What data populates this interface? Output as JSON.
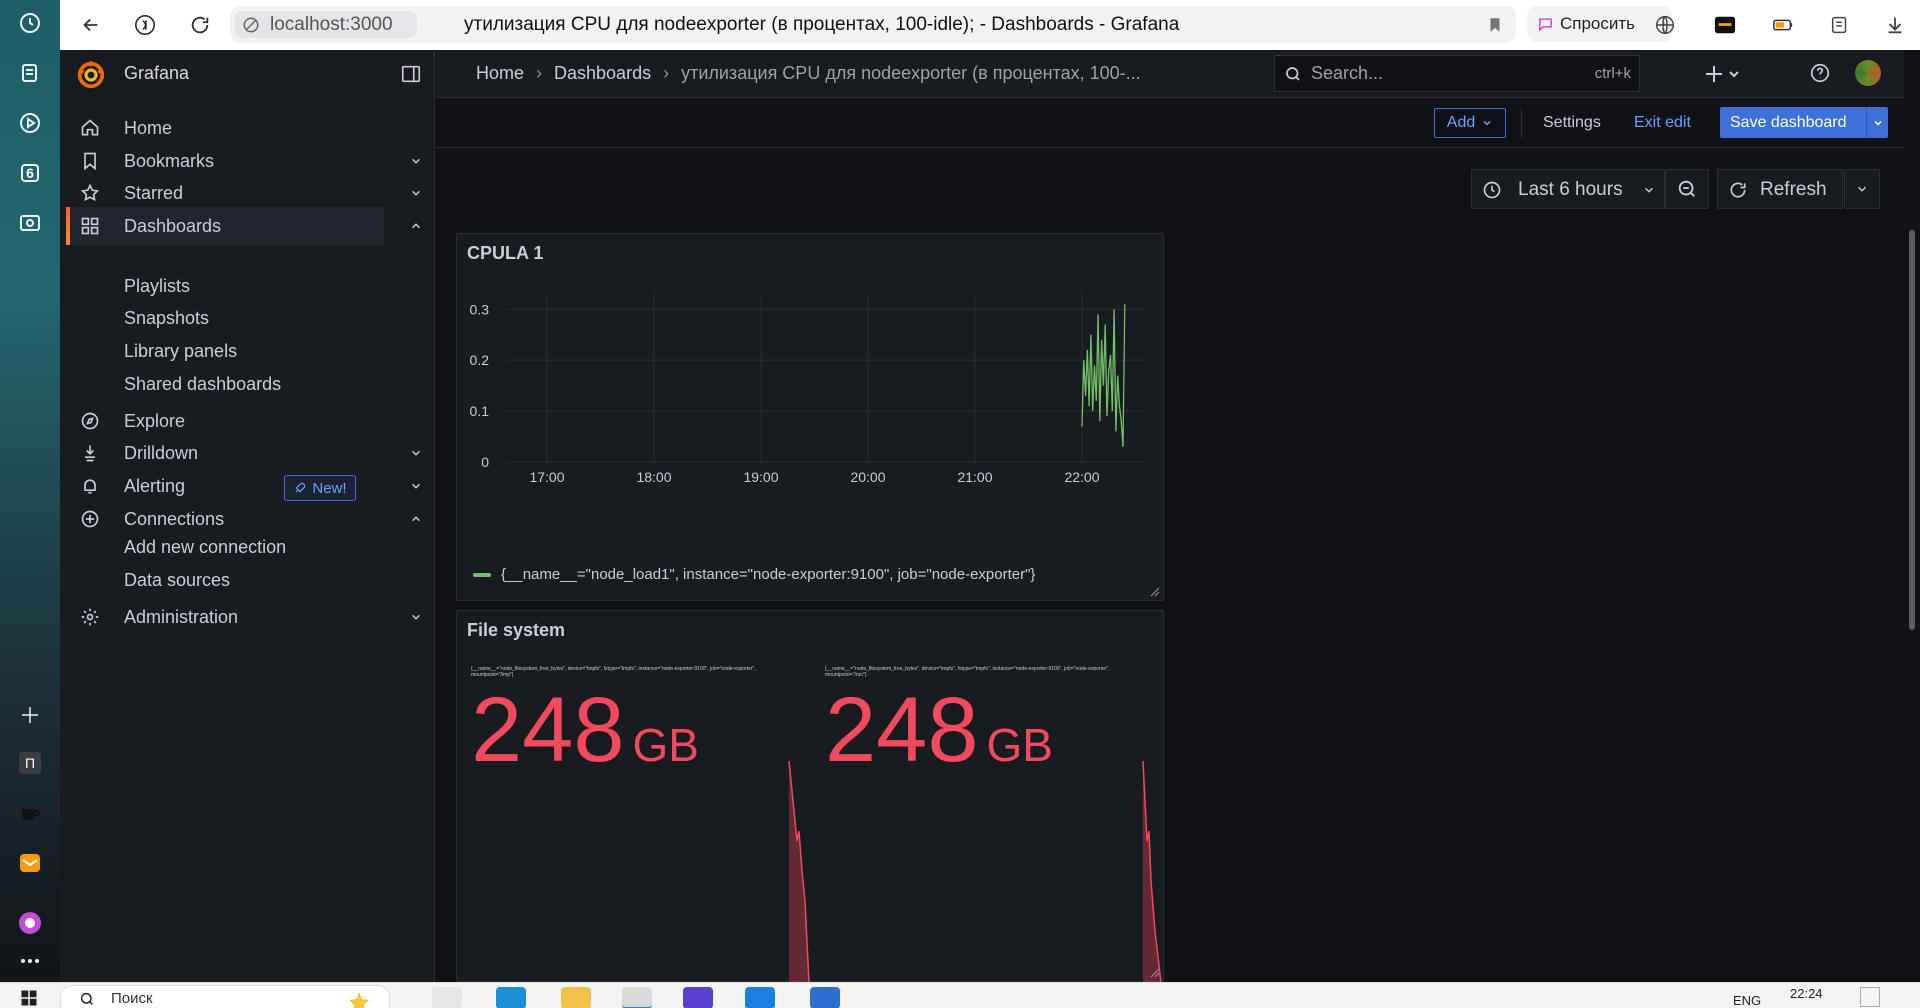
{
  "browser": {
    "address_host": "localhost:3000",
    "tab_title": "утилизация CPU для nodeexporter (в процентах, 100-idle); - Dashboards - Grafana",
    "ask_label": "Спросить",
    "rail_badge": "6",
    "rail_letter": "П"
  },
  "grafana": {
    "brand": "Grafana",
    "nav": {
      "home": "Home",
      "bookmarks": "Bookmarks",
      "starred": "Starred",
      "dashboards": "Dashboards",
      "playlists": "Playlists",
      "snapshots": "Snapshots",
      "library_panels": "Library panels",
      "shared_dashboards": "Shared dashboards",
      "explore": "Explore",
      "drilldown": "Drilldown",
      "new_badge": "New!",
      "alerting": "Alerting",
      "connections": "Connections",
      "add_new_connection": "Add new connection",
      "data_sources": "Data sources",
      "administration": "Administration"
    },
    "breadcrumb": {
      "home": "Home",
      "dashboards": "Dashboards",
      "current": "утилизация CPU для nodeexporter (в процентах, 100-..."
    },
    "search": {
      "placeholder": "Search...",
      "shortcut": "ctrl+k"
    },
    "toolbar": {
      "add_label": "Add",
      "settings_label": "Settings",
      "exit_edit_label": "Exit edit",
      "save_label": "Save dashboard"
    },
    "time_picker": {
      "label": "Last 6 hours"
    },
    "refresh_label": "Refresh"
  },
  "panels": {
    "cpu": {
      "title": "CPULA 1",
      "legend": "{__name__=\"node_load1\", instance=\"node-exporter:9100\", job=\"node-exporter\"}",
      "series_color": "#73bf69"
    },
    "fs": {
      "title": "File system",
      "stat1_label": "{__name__=\"node_filesystem_free_bytes\", device=\"tmpfs\", fstype=\"tmpfs\", instance=\"node-exporter:9100\", job=\"node-exporter\", mountpoint=\"/tmp\"}",
      "stat2_label": "{__name__=\"node_filesystem_free_bytes\", device=\"tmpfs\", fstype=\"tmpfs\", instance=\"node-exporter:9100\", job=\"node-exporter\", mountpoint=\"/run\"}",
      "stat1_value": "248",
      "stat2_value": "248",
      "unit": "GB",
      "value_color": "#f2495c"
    }
  },
  "chart_data": {
    "type": "line",
    "title": "CPULA 1",
    "x_ticks": [
      "17:00",
      "18:00",
      "19:00",
      "20:00",
      "21:00",
      "22:00"
    ],
    "y_ticks": [
      "0",
      "0.1",
      "0.2",
      "0.3"
    ],
    "ylim": [
      0,
      0.33
    ],
    "x": [
      "22:00",
      "22:01",
      "22:02",
      "22:03",
      "22:04",
      "22:05",
      "22:06",
      "22:07",
      "22:08",
      "22:09",
      "22:10",
      "22:11",
      "22:12",
      "22:13",
      "22:14",
      "22:15",
      "22:16",
      "22:17",
      "22:18",
      "22:19",
      "22:20",
      "22:21",
      "22:22",
      "22:23",
      "22:24"
    ],
    "series": [
      {
        "name": "{__name__=\"node_load1\", instance=\"node-exporter:9100\", job=\"node-exporter\"}",
        "values": [
          0.07,
          0.2,
          0.13,
          0.22,
          0.11,
          0.25,
          0.1,
          0.19,
          0.12,
          0.29,
          0.08,
          0.24,
          0.15,
          0.27,
          0.09,
          0.18,
          0.21,
          0.1,
          0.3,
          0.06,
          0.17,
          0.11,
          0.08,
          0.03,
          0.31
        ]
      }
    ],
    "legend_placement": "bottom",
    "grid": true
  },
  "taskbar": {
    "search_text": "Поиск",
    "lang": "ENG",
    "time": "22:24"
  }
}
